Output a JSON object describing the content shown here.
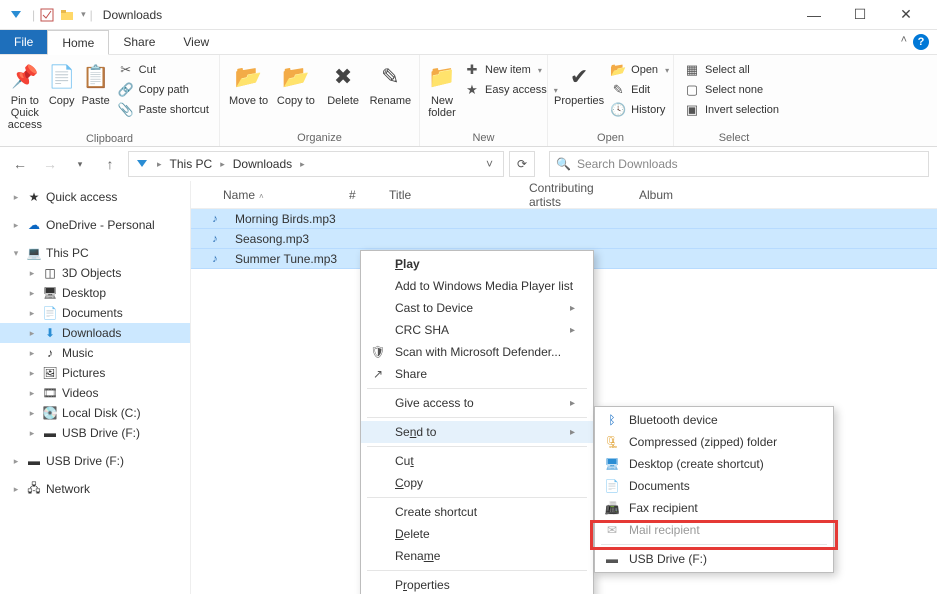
{
  "title": "Downloads",
  "ribbon_tabs": {
    "file": "File",
    "home": "Home",
    "share": "Share",
    "view": "View"
  },
  "ribbon": {
    "clipboard": {
      "pin": "Pin to Quick access",
      "copy": "Copy",
      "paste": "Paste",
      "cut": "Cut",
      "copy_path": "Copy path",
      "paste_shortcut": "Paste shortcut",
      "label": "Clipboard"
    },
    "organize": {
      "move": "Move to",
      "copy": "Copy to",
      "delete": "Delete",
      "rename": "Rename",
      "label": "Organize"
    },
    "new": {
      "folder": "New folder",
      "item": "New item",
      "easy": "Easy access",
      "label": "New"
    },
    "open": {
      "properties": "Properties",
      "open": "Open",
      "edit": "Edit",
      "history": "History",
      "label": "Open"
    },
    "select": {
      "all": "Select all",
      "none": "Select none",
      "invert": "Invert selection",
      "label": "Select"
    }
  },
  "breadcrumb": {
    "pc": "This PC",
    "dl": "Downloads"
  },
  "search_placeholder": "Search Downloads",
  "tree": {
    "quick": "Quick access",
    "onedrive": "OneDrive - Personal",
    "thispc": "This PC",
    "items": {
      "obj": "3D Objects",
      "desk": "Desktop",
      "docs": "Documents",
      "dl": "Downloads",
      "music": "Music",
      "pics": "Pictures",
      "vids": "Videos",
      "local": "Local Disk (C:)",
      "usb": "USB Drive (F:)"
    },
    "usb2": "USB Drive (F:)",
    "network": "Network"
  },
  "columns": {
    "name": "Name",
    "num": "#",
    "title": "Title",
    "art": "Contributing artists",
    "alb": "Album"
  },
  "files": [
    {
      "name": "Morning Birds.mp3"
    },
    {
      "name": "Seasong.mp3"
    },
    {
      "name": "Summer Tune.mp3"
    }
  ],
  "ctx": {
    "play": "Play",
    "wmp": "Add to Windows Media Player list",
    "cast": "Cast to Device",
    "crc": "CRC SHA",
    "defender": "Scan with Microsoft Defender...",
    "share": "Share",
    "give": "Give access to",
    "send": "Send to",
    "cut_m": "Cut",
    "copy_m": "Copy",
    "shortcut": "Create shortcut",
    "delete_m": "Delete",
    "rename_m": "Rename",
    "props": "Properties"
  },
  "send": {
    "bt": "Bluetooth device",
    "zip": "Compressed (zipped) folder",
    "desk": "Desktop (create shortcut)",
    "docs": "Documents",
    "fax": "Fax recipient",
    "mail": "Mail recipient",
    "usb": "USB Drive (F:)"
  }
}
